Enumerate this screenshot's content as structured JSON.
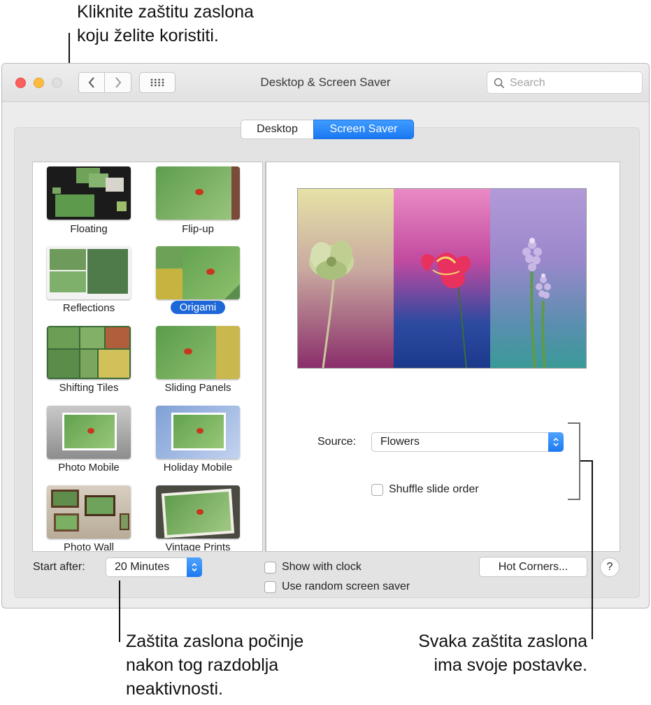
{
  "callouts": {
    "top_line1": "Kliknite zaštitu zaslona",
    "top_line2": "koju želite koristiti.",
    "bottom_left_line1": "Zaštita zaslona počinje",
    "bottom_left_line2": "nakon tog razdoblja",
    "bottom_left_line3": "neaktivnosti.",
    "bottom_right_line1": "Svaka zaštita zaslona",
    "bottom_right_line2": "ima svoje postavke."
  },
  "window": {
    "title": "Desktop & Screen Saver",
    "search_placeholder": "Search"
  },
  "tabs": {
    "desktop": "Desktop",
    "screen_saver": "Screen Saver"
  },
  "savers": [
    {
      "label": "Floating"
    },
    {
      "label": "Flip-up"
    },
    {
      "label": "Reflections"
    },
    {
      "label": "Origami"
    },
    {
      "label": "Shifting Tiles"
    },
    {
      "label": "Sliding Panels"
    },
    {
      "label": "Photo Mobile"
    },
    {
      "label": "Holiday Mobile"
    },
    {
      "label": "Photo Wall"
    },
    {
      "label": "Vintage Prints"
    }
  ],
  "selected_saver": "Origami",
  "options": {
    "source_label": "Source:",
    "source_value": "Flowers",
    "shuffle_label": "Shuffle slide order"
  },
  "bottom": {
    "start_after_label": "Start after:",
    "start_after_value": "20 Minutes",
    "show_clock_label": "Show with clock",
    "random_label": "Use random screen saver",
    "hot_corners": "Hot Corners...",
    "help": "?"
  },
  "colors": {
    "accent": "#1e67d8",
    "close": "#fc605c",
    "minimize": "#fdbc40"
  }
}
